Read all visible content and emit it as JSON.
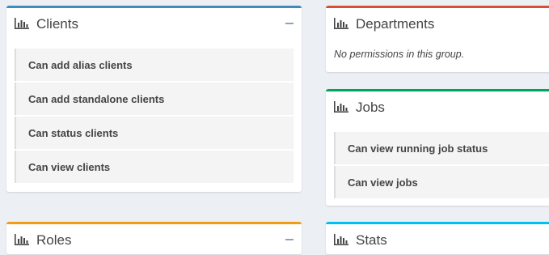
{
  "colors": {
    "clients": "#3c8dbc",
    "departments": "#dd4b39",
    "jobs": "#00a65a",
    "roles": "#f39c12",
    "stats": "#00c0ef"
  },
  "icon": "bar-chart-icon",
  "clients": {
    "title": "Clients",
    "items": [
      "Can add alias clients",
      "Can add standalone clients",
      "Can status clients",
      "Can view clients"
    ]
  },
  "departments": {
    "title": "Departments",
    "empty_message": "No permissions in this group."
  },
  "jobs": {
    "title": "Jobs",
    "items": [
      "Can view running job status",
      "Can view jobs"
    ]
  },
  "roles": {
    "title": "Roles"
  },
  "stats": {
    "title": "Stats"
  }
}
